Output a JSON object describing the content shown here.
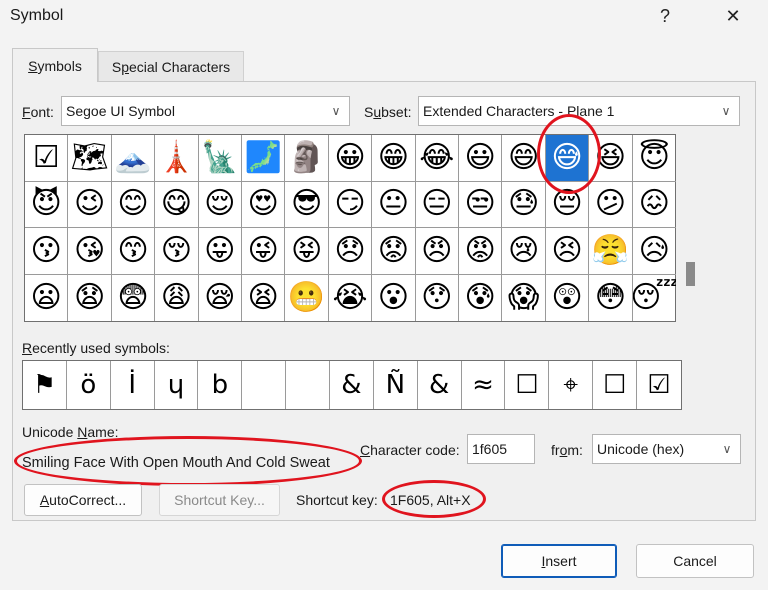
{
  "window": {
    "title": "Symbol",
    "help_glyph": "?",
    "close_glyph": "✕"
  },
  "tabs": [
    {
      "label_u": "S",
      "label_rest": "ymbols",
      "active": true
    },
    {
      "label_pre": "S",
      "label_u": "p",
      "label_rest": "ecial Characters",
      "active": false
    }
  ],
  "font": {
    "label_u": "F",
    "label_rest": "ont:",
    "value": "Segoe UI Symbol"
  },
  "subset": {
    "label_pre": "S",
    "label_u": "u",
    "label_rest": "bset:",
    "value": "Extended Characters - Plane 1"
  },
  "grid": {
    "rows": [
      [
        "☑",
        "🗺",
        "🗻",
        "🗼",
        "🗽",
        "🗾",
        "🗿",
        "😀",
        "😁",
        "😂",
        "😃",
        "😄",
        "😅",
        "😆",
        "😇"
      ],
      [
        "😈",
        "😉",
        "😊",
        "😋",
        "😌",
        "😍",
        "😎",
        "😏",
        "😐",
        "😑",
        "😒",
        "😓",
        "😔",
        "😕",
        "😖"
      ],
      [
        "😗",
        "😘",
        "😙",
        "😚",
        "😛",
        "😜",
        "😝",
        "😞",
        "😟",
        "😠",
        "😡",
        "😢",
        "😣",
        "😤",
        "😥"
      ],
      [
        "😦",
        "😧",
        "😨",
        "😩",
        "😪",
        "😫",
        "😬",
        "😭",
        "😮",
        "😯",
        "😰",
        "😱",
        "😲",
        "😳",
        "😴"
      ]
    ],
    "selected": {
      "row": 0,
      "col": 12
    }
  },
  "recent": {
    "label_u": "R",
    "label_rest": "ecently used symbols:",
    "items": [
      "⚑",
      "ö",
      "İ",
      "ɥ",
      "b",
      "",
      "",
      "&",
      "Ñ",
      "&",
      "≈",
      "☐",
      "⌖",
      "☐",
      "☑"
    ]
  },
  "unicode_name": {
    "label_u": "N",
    "label_pre": "Unicode ",
    "label_rest": "ame:",
    "value": "Smiling Face With Open Mouth And Cold Sweat"
  },
  "character_code": {
    "label_u": "C",
    "label_rest": "haracter code:",
    "value": "1f605"
  },
  "from": {
    "label_pre": "fr",
    "label_u": "o",
    "label_rest": "m:",
    "value": "Unicode (hex)"
  },
  "buttons": {
    "autocorrect": {
      "label_u": "A",
      "label_rest": "utoCorrect..."
    },
    "shortcut_key": {
      "label": "Shortcut Key..."
    },
    "insert": {
      "label_u": "I",
      "label_rest": "nsert"
    },
    "cancel": {
      "label": "Cancel"
    }
  },
  "shortcut": {
    "label": "Shortcut key:",
    "value": "1F605, Alt+X"
  },
  "colors": {
    "selection": "#1e73d2",
    "highlight_ring": "#e0141e"
  }
}
